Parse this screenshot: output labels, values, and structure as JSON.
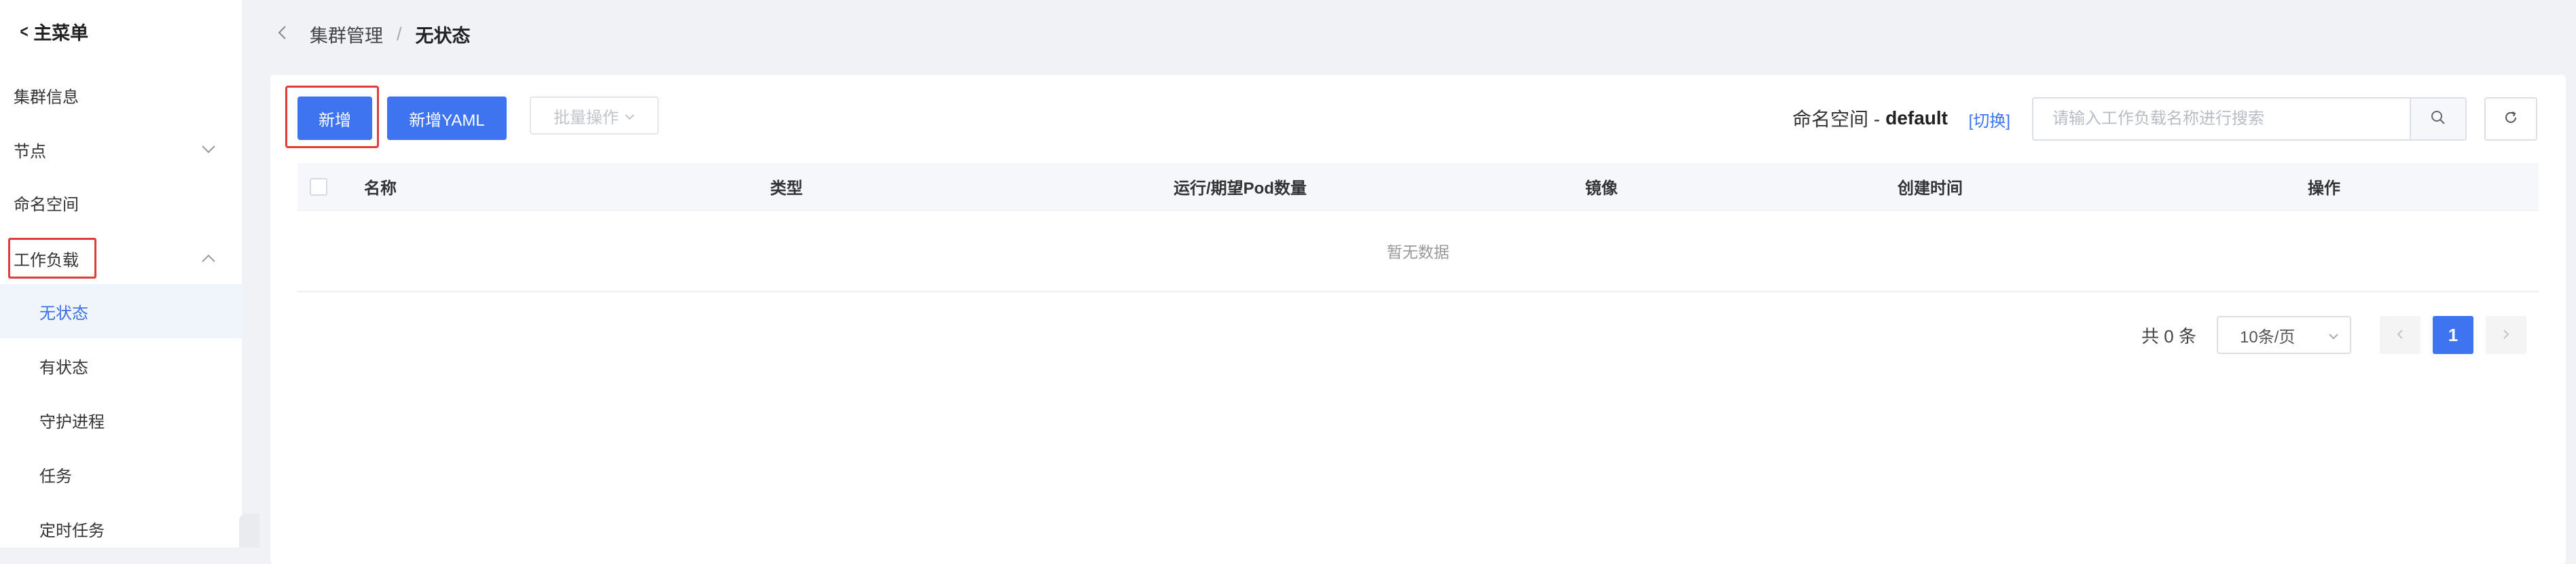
{
  "sidebar": {
    "back_label": "主菜单",
    "items": [
      {
        "label": "集群信息"
      },
      {
        "label": "节点"
      },
      {
        "label": "命名空间"
      },
      {
        "label": "工作负载"
      },
      {
        "label": "无状态"
      },
      {
        "label": "有状态"
      },
      {
        "label": "守护进程"
      },
      {
        "label": "任务"
      },
      {
        "label": "定时任务"
      }
    ]
  },
  "breadcrumb": {
    "parent": "集群管理",
    "separator": "/",
    "current": "无状态"
  },
  "toolbar": {
    "add_label": "新增",
    "add_yaml_label": "新增YAML",
    "batch_label": "批量操作"
  },
  "namespace": {
    "label": "命名空间 -",
    "value": "default",
    "switch_label": "[切换]"
  },
  "search": {
    "placeholder": "请输入工作负载名称进行搜索",
    "value": ""
  },
  "table": {
    "columns": [
      "名称",
      "类型",
      "运行/期望Pod数量",
      "镜像",
      "创建时间",
      "操作"
    ],
    "empty_text": "暂无数据"
  },
  "pagination": {
    "total_text": "共 0 条",
    "page_size": "10条/页",
    "current_page": "1"
  },
  "colors": {
    "primary": "#3e74ef",
    "highlight_border": "#e23b3b",
    "active_text": "#3b6fe6"
  }
}
